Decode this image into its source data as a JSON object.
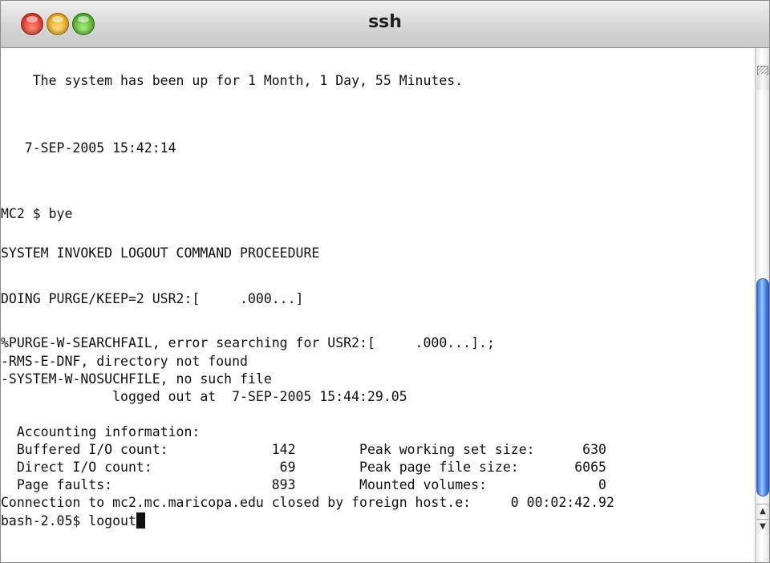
{
  "window": {
    "title": "ssh"
  },
  "terminal": {
    "lines": [
      "    The system has been up for 1 Month, 1 Day, 55 Minutes.",
      "   7-SEP-2005 15:42:14",
      "MC2 $ bye",
      "SYSTEM INVOKED LOGOUT COMMAND PROCEEDURE",
      "DOING PURGE/KEEP=2 USR2:[     .000...]",
      "%PURGE-W-SEARCHFAIL, error searching for USR2:[     .000...].;",
      "-RMS-E-DNF, directory not found",
      "-SYSTEM-W-NOSUCHFILE, no such file",
      "              logged out at  7-SEP-2005 15:44:29.05",
      "  Accounting information:",
      "  Buffered I/O count:             142        Peak working set size:      630",
      "  Direct I/O count:                69        Peak page file size:       6065",
      "  Page faults:                    893        Mounted volumes:              0",
      "Connection to mc2.mc.maricopa.edu closed by foreign host.e:     0 00:02:42.92",
      "bash-2.05$ logout"
    ]
  },
  "scrollbar": {
    "position": 0.72,
    "up_glyph": "▲",
    "down_glyph": "▼"
  },
  "icons": {
    "close": "close-button",
    "minimize": "minimize-button",
    "zoom": "zoom-button"
  }
}
